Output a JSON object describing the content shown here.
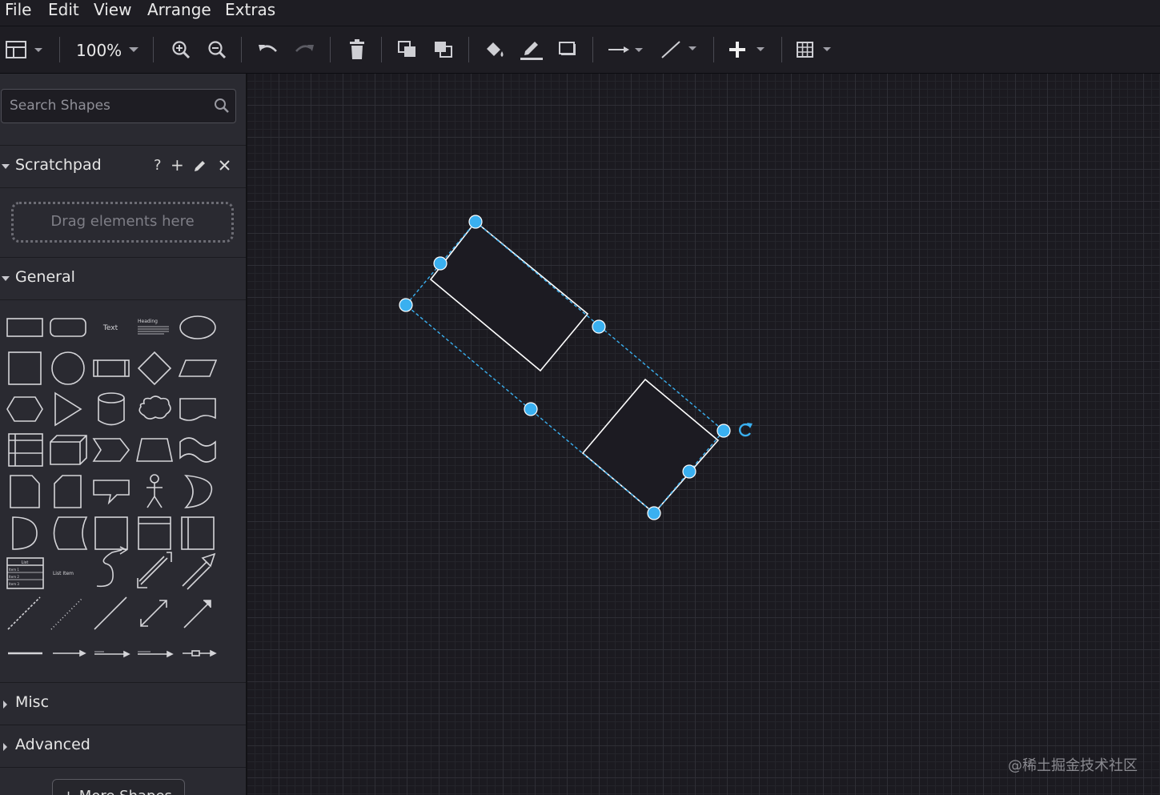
{
  "menu": {
    "items": [
      "File",
      "Edit",
      "View",
      "Arrange",
      "Extras"
    ]
  },
  "toolbar": {
    "zoom_label": "100%"
  },
  "sidebar": {
    "search_placeholder": "Search Shapes",
    "scratchpad": {
      "title": "Scratchpad",
      "help": "?",
      "add": "+",
      "dropzone_text": "Drag elements here"
    },
    "sections": {
      "general": "General",
      "misc": "Misc",
      "advanced": "Advanced"
    },
    "shape_labels": {
      "text": "Text",
      "heading": "Heading",
      "list": "List",
      "list_item": "List Item",
      "item1": "Item 1",
      "item2": "Item 2",
      "item3": "Item 3"
    },
    "more_shapes": "+ More Shapes"
  },
  "canvas": {
    "watermark": "@稀土掘金技术社区"
  },
  "colors": {
    "selection": "#3ab0f0",
    "background": "#1b1a20",
    "panel": "#2a2a31",
    "grid": "#2e2e35"
  }
}
